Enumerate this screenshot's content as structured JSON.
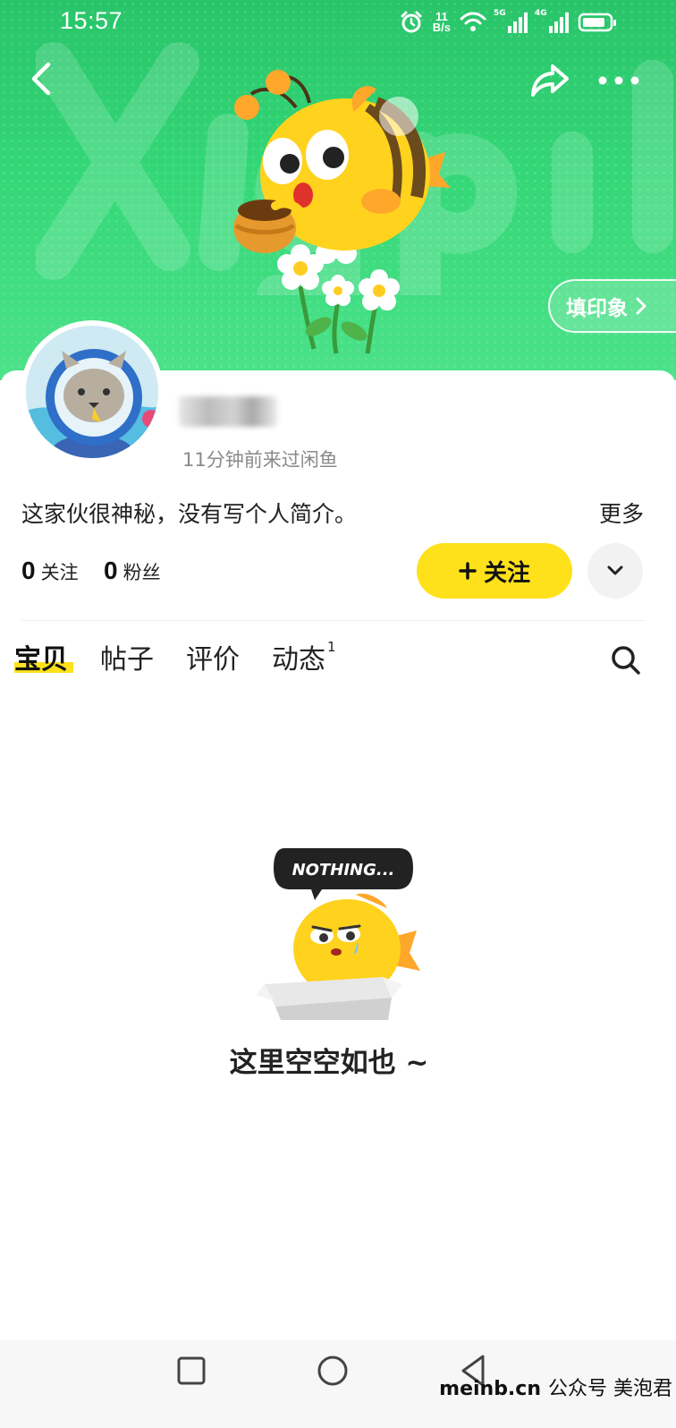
{
  "status_bar": {
    "time": "15:57",
    "speed_value": "11",
    "speed_unit": "B/s",
    "signal_1": "5G",
    "signal_2": "4G",
    "icons": [
      "alarm-icon",
      "wifi-icon",
      "signal-5g-icon",
      "signal-4g-icon",
      "battery-icon"
    ]
  },
  "header": {
    "back_icon": "chevron-left-icon",
    "share_icon": "share-icon",
    "more_icon": "more-dots-icon",
    "impression_button": "填印象",
    "banner_color": "#34d777"
  },
  "profile": {
    "username": "",
    "last_seen": "11分钟前来过闲鱼",
    "bio": "这家伙很神秘，没有写个人简介。",
    "more_label": "更多",
    "following_count": "0",
    "following_label": "关注",
    "followers_count": "0",
    "followers_label": "粉丝",
    "follow_button": "关注",
    "follow_button_color": "#ffe11b"
  },
  "tabs": [
    {
      "label": "宝贝",
      "active": true
    },
    {
      "label": "帖子",
      "active": false
    },
    {
      "label": "评价",
      "active": false
    },
    {
      "label": "动态",
      "active": false,
      "badge": "1"
    }
  ],
  "empty_state": {
    "bubble_text": "NOTHING...",
    "message": "这里空空如也 ~"
  },
  "system_nav": {
    "icons": [
      "recent-apps-icon",
      "home-icon",
      "back-triangle-icon"
    ]
  },
  "watermark": {
    "site": "meinb.cn",
    "account": "公众号 美泡君"
  }
}
